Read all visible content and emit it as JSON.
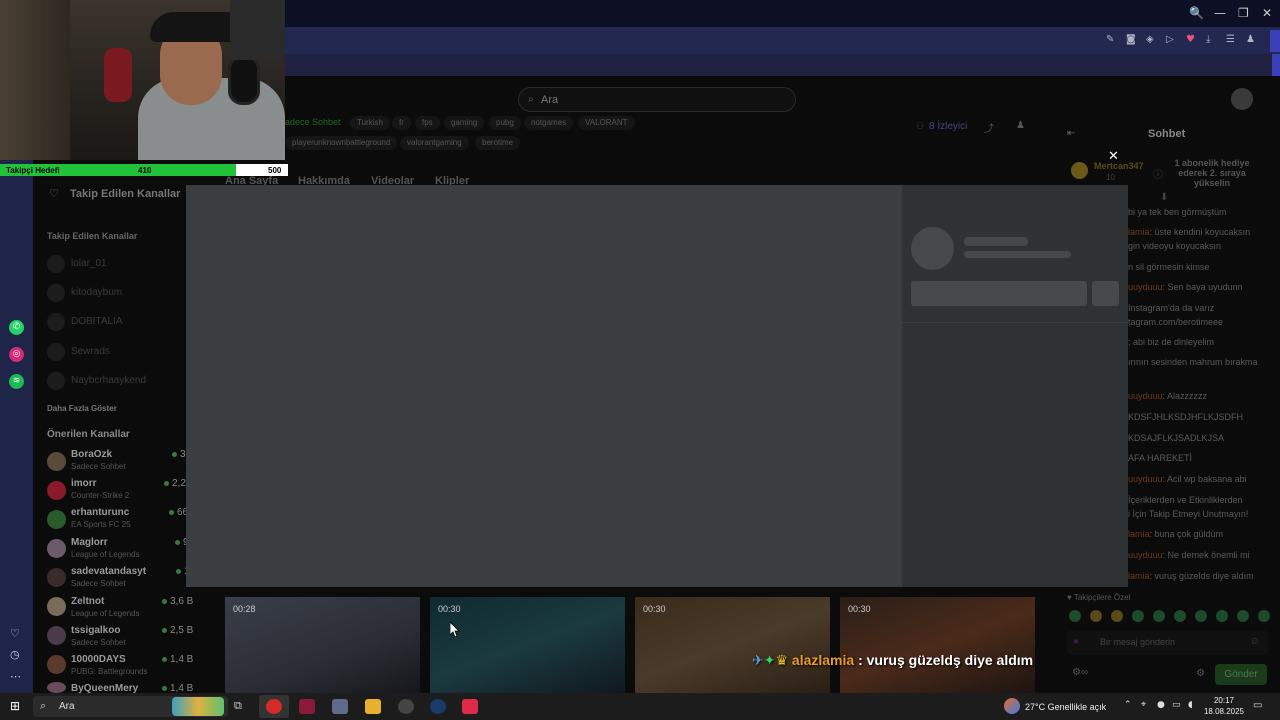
{
  "browser": {
    "window_controls": [
      "🔍",
      "—",
      "❐",
      "✕"
    ]
  },
  "search": {
    "placeholder": "Ara"
  },
  "stream": {
    "category_label": "adece Sohbet",
    "tags": [
      "Turkish",
      "fr",
      "fps",
      "gaming",
      "pubg",
      "notgames",
      "VALORANT"
    ],
    "tags_row2": [
      "playerunknownbattleground",
      "valorantgaming",
      "berotime"
    ],
    "viewers": "8 İzleyici",
    "tabs": [
      "Ana Sayfa",
      "Hakkımda",
      "Videolar",
      "Klipler"
    ]
  },
  "sidebar": {
    "header": "Takip Edilen Kanallar",
    "followed_title": "Takip Edilen Kanallar",
    "followed": [
      "lolar_01",
      "kitodaybum",
      "DOBITALIA",
      "Sewrads",
      "Naybcrhaaykend"
    ],
    "show_more": "Daha Fazla Göster",
    "recommended_title": "Önerilen Kanallar",
    "recommended": [
      {
        "name": "BoraOzk",
        "sub": "Sadece Sohbet",
        "viewers": "36"
      },
      {
        "name": "imorr",
        "sub": "Counter-Strike 2",
        "viewers": "2,2"
      },
      {
        "name": "erhanturunc",
        "sub": "EA Sports FC 25",
        "viewers": "66"
      },
      {
        "name": "Maglorr",
        "sub": "League of Legends",
        "viewers": "9"
      },
      {
        "name": "sadevatandasyt",
        "sub": "Sadece Sohbet",
        "viewers": "1"
      },
      {
        "name": "Zeltnot",
        "sub": "League of Legends",
        "viewers": "3,6 B"
      },
      {
        "name": "tssigalkoo",
        "sub": "Sadece Sohbet",
        "viewers": "2,5 B"
      },
      {
        "name": "10000DAYS",
        "sub": "PUBG: Battlegrounds",
        "viewers": "1,4 B"
      },
      {
        "name": "ByQueenMery",
        "sub": "",
        "viewers": "1,4 B"
      }
    ]
  },
  "chat": {
    "title": "Sohbet",
    "sub_gift_user": "Mertcan347",
    "sub_gift_count": "10",
    "sub_gift_text": "1 abonelik hediye ederek 2. sıraya yükselin",
    "lines": [
      {
        "user": "",
        "text": "bi ya tek ben görmüştüm"
      },
      {
        "user": "lamia",
        "text": ": üste kendini koyucaksın"
      },
      {
        "user": "",
        "text": "gin videoyu koyucaksın"
      },
      {
        "user": "",
        "text": "n sil görmesin kimse"
      },
      {
        "user": "uuyduuu",
        "text": ": Sen baya uyudunn"
      },
      {
        "user": "",
        "text": "Instagram'da da varız"
      },
      {
        "user": "",
        "text": "tagram.com/berotimeee"
      },
      {
        "user": "",
        "text": "; abi biz de dinleyelim"
      },
      {
        "user": "",
        "text": "ırının sesinden mahrum bırakma"
      },
      {
        "user": "uuyduuu",
        "text": ": Alazzzzzz"
      },
      {
        "user": "",
        "text": "KDSFJHLKSDJHFLKJSDFH"
      },
      {
        "user": "",
        "text": "KDSAJFLKJSADLKJSA"
      },
      {
        "user": "",
        "text": "AFA HAREKETİ"
      },
      {
        "user": "uuyduuu",
        "text": ": Acil wp baksana abi"
      },
      {
        "user": "",
        "text": "İçeriklerden ve Etkinliklerden"
      },
      {
        "user": "",
        "text": "i İçin Takip Etmeyi Unutmayın!"
      },
      {
        "user": "lamia",
        "text": ": buna çok güldüm"
      },
      {
        "user": "uuyduuu",
        "text": ": Ne demek önemli mi"
      },
      {
        "user": "lamia",
        "text": ": vuruş güzelds diye aldım"
      }
    ],
    "followers_only": "Takipçilere Özel",
    "input_placeholder": "Bir mesaj gönderin",
    "send_label": "Gönder"
  },
  "clips": [
    {
      "duration": "00:28"
    },
    {
      "duration": "00:30"
    },
    {
      "duration": "00:30"
    },
    {
      "duration": "00:30"
    }
  ],
  "overlay": {
    "follower_goal_label": "Takipçi Hedefi",
    "follower_goal_current": "410",
    "follower_goal_target": "500",
    "follower_goal_progress": 0.82,
    "chat_user": "alazlamia",
    "chat_message": " : vuruş güzeldş diye aldım"
  },
  "taskbar": {
    "search_placeholder": "Ara",
    "weather": "27°C  Genellikle açık",
    "time": "20:17",
    "date": "18.08.2025"
  }
}
